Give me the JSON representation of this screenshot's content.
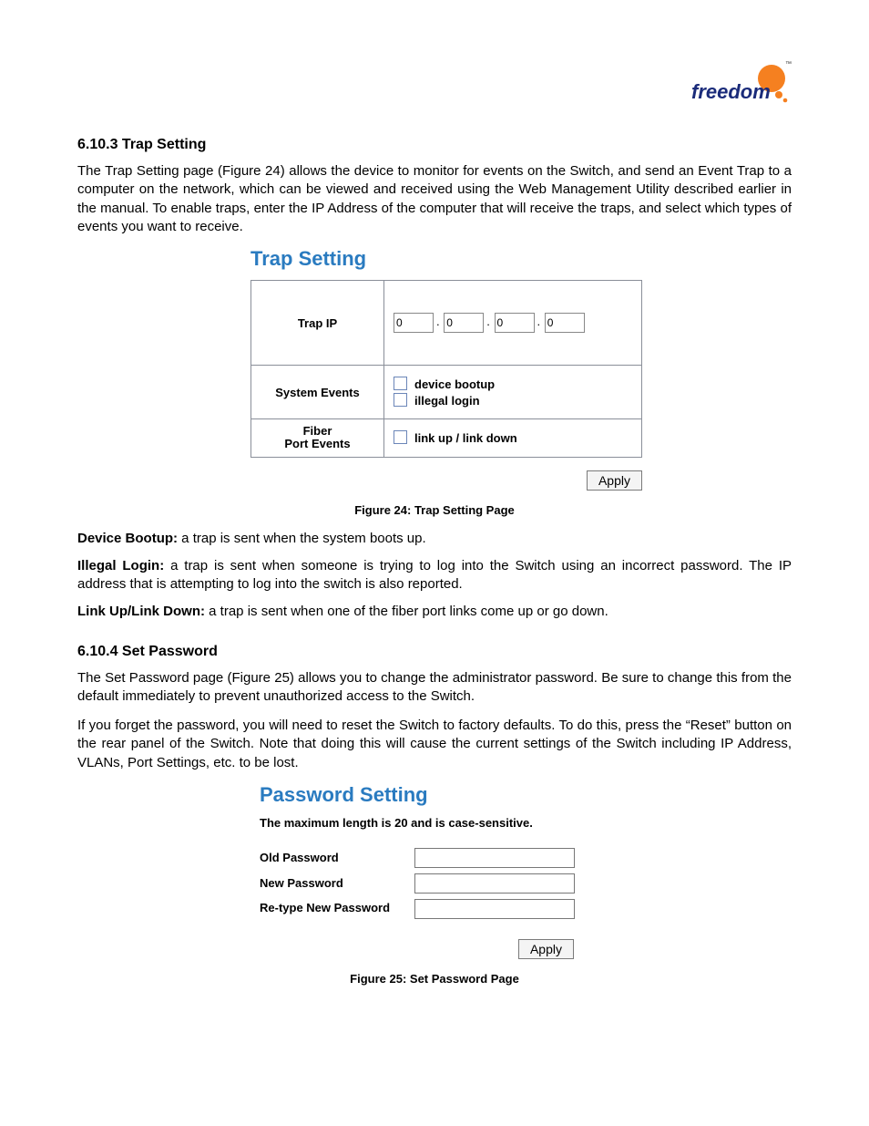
{
  "logo": {
    "brand": "freedom",
    "tm": "™"
  },
  "sections": {
    "trap": {
      "heading": "6.10.3 Trap Setting",
      "intro": "The Trap Setting page (Figure 24) allows the device to monitor for events on the Switch, and send an Event Trap to a computer on the network, which can be viewed and received using the Web Management Utility described earlier in the manual.  To enable traps, enter the IP Address of the computer that will receive the traps, and select which types of events you want to receive.",
      "panel_title": "Trap Setting",
      "rows": {
        "trap_ip_label": "Trap IP",
        "ip_octets": [
          "0",
          "0",
          "0",
          "0"
        ],
        "system_events_label": "System Events",
        "system_events": {
          "opt1": "device bootup",
          "opt2": "illegal login"
        },
        "fiber_label_line1": "Fiber",
        "fiber_label_line2": "Port Events",
        "fiber_events": {
          "opt1": "link up / link down"
        }
      },
      "apply_label": "Apply",
      "figure_caption": "Figure 24: Trap Setting Page",
      "defs": {
        "d1_term": "Device Bootup:",
        "d1_text": " a trap is sent when the system boots up.",
        "d2_term": "Illegal Login:",
        "d2_text": " a trap is sent when someone is trying to log into the Switch using an incorrect password.  The IP address that is attempting to log into the switch is also reported.",
        "d3_term": "Link Up/Link Down:",
        "d3_text": " a trap is sent when one of the fiber port links come up or go down."
      }
    },
    "pw": {
      "heading": "6.10.4 Set Password",
      "p1": "The Set Password page (Figure 25) allows you to change the administrator password.  Be sure to change this from the default immediately to prevent unauthorized access to the Switch.",
      "p2": "If you forget the password, you will need to reset the Switch to factory defaults.  To do this, press the “Reset” button on the rear panel of the Switch.  Note that doing this will cause the current settings of the Switch including IP Address, VLANs, Port Settings, etc. to be lost.",
      "panel_title": "Password Setting",
      "note": "The maximum length is 20 and is case-sensitive.",
      "labels": {
        "old": "Old Password",
        "new": "New Password",
        "re": "Re-type New Password"
      },
      "apply_label": "Apply",
      "figure_caption": "Figure 25: Set Password Page"
    }
  }
}
